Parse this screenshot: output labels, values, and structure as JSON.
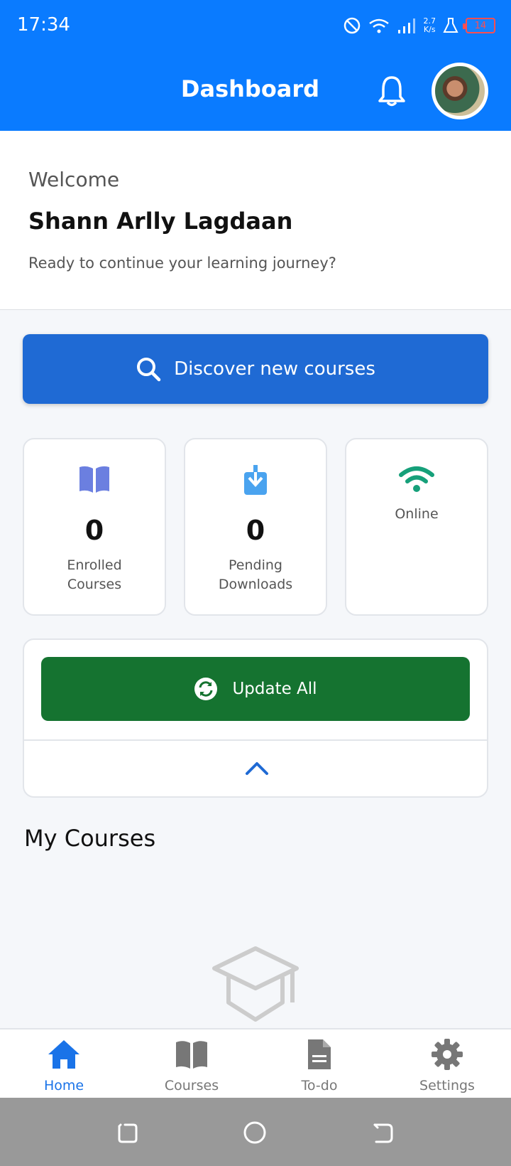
{
  "status_bar": {
    "time": "17:34",
    "net_speed_value": "2.7",
    "net_speed_unit": "K/s",
    "battery": "14"
  },
  "header": {
    "title": "Dashboard"
  },
  "welcome": {
    "greeting": "Welcome",
    "name": "Shann Arlly Lagdaan",
    "subtitle": "Ready to continue your learning journey?"
  },
  "discover_button": {
    "label": "Discover new courses"
  },
  "stats": {
    "enrolled": {
      "value": "0",
      "label_line1": "Enrolled",
      "label_line2": "Courses",
      "icon": "book-icon",
      "color": "#6b7fe0"
    },
    "pending": {
      "value": "0",
      "label_line1": "Pending",
      "label_line2": "Downloads",
      "icon": "download-icon",
      "color": "#4aa3ef"
    },
    "connection": {
      "label": "Online",
      "icon": "wifi-icon",
      "color": "#16a07a"
    }
  },
  "update_panel": {
    "button_label": "Update All"
  },
  "my_courses": {
    "heading": "My Courses"
  },
  "bottom_nav": {
    "items": [
      {
        "label": "Home",
        "icon": "home-icon",
        "active": true
      },
      {
        "label": "Courses",
        "icon": "book-icon",
        "active": false
      },
      {
        "label": "To-do",
        "icon": "document-icon",
        "active": false
      },
      {
        "label": "Settings",
        "icon": "gear-icon",
        "active": false
      }
    ]
  },
  "colors": {
    "primary": "#0a7bff",
    "discover": "#1f6ad4",
    "update": "#157330",
    "nav_active": "#1a73e8"
  }
}
